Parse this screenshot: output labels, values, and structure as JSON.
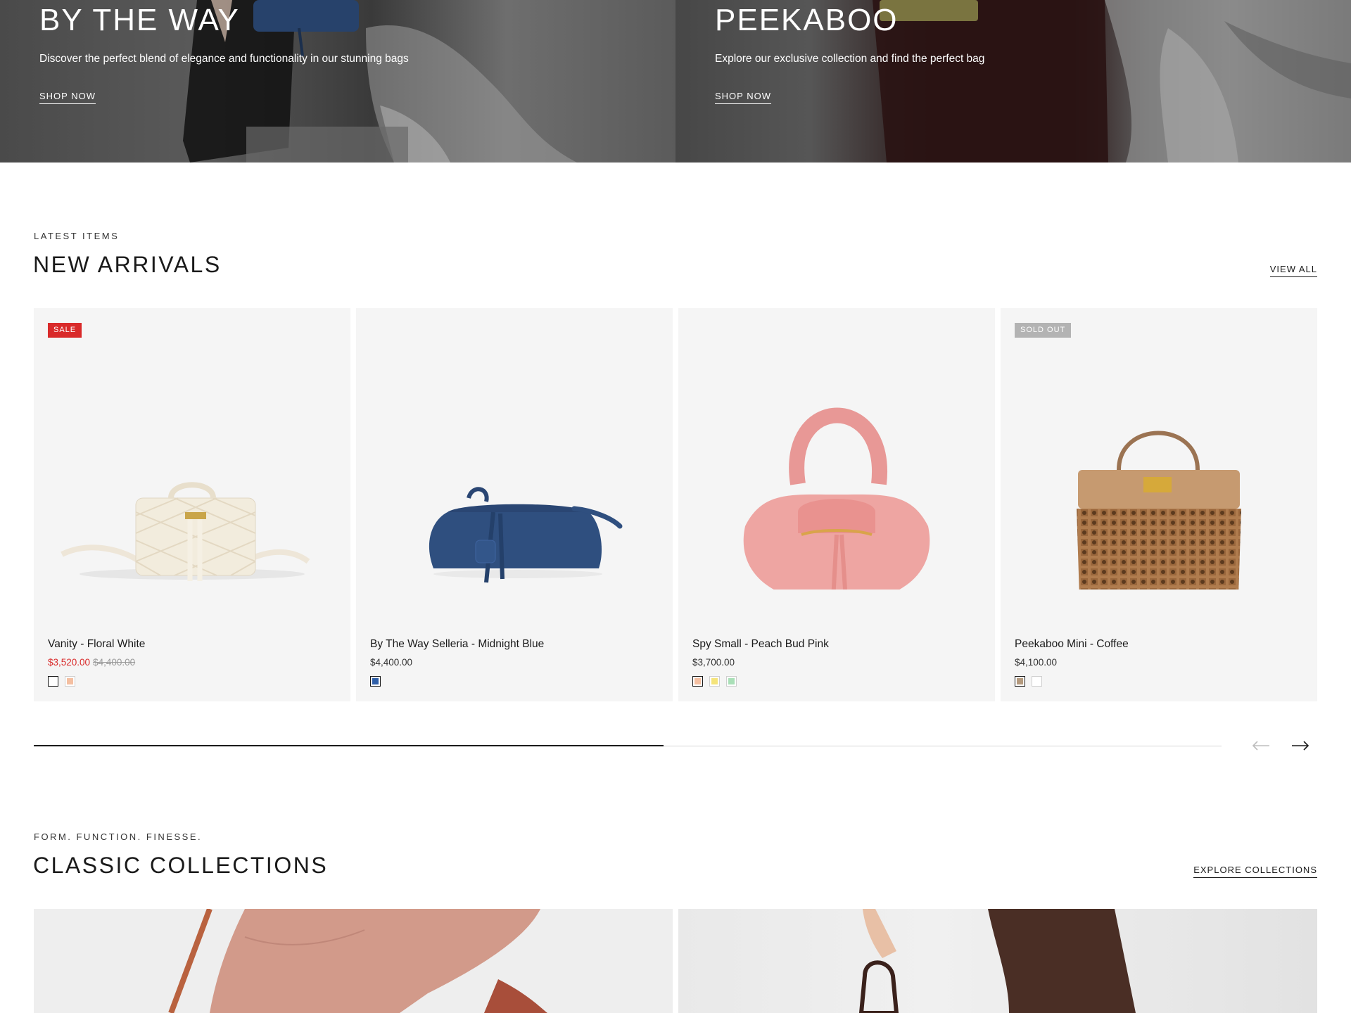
{
  "hero": [
    {
      "title": "BY THE WAY",
      "description": "Discover the perfect blend of elegance and functionality in our stunning bags",
      "cta": "SHOP NOW"
    },
    {
      "title": "PEEKABOO",
      "description": "Explore our exclusive collection and find the perfect bag",
      "cta": "SHOP NOW"
    }
  ],
  "new_arrivals": {
    "eyebrow": "LATEST ITEMS",
    "title": "NEW ARRIVALS",
    "view_all": "VIEW ALL",
    "products": [
      {
        "badge": "SALE",
        "name": "Vanity - Floral White",
        "price": "$3,520.00",
        "old_price": "$4,400.00",
        "swatches": [
          "#ffffff",
          "#f4bfa1"
        ]
      },
      {
        "badge": "",
        "name": "By The Way Selleria - Midnight Blue",
        "price": "$4,400.00",
        "old_price": "",
        "swatches": [
          "#2f5fa8"
        ]
      },
      {
        "badge": "",
        "name": "Spy Small - Peach Bud Pink",
        "price": "$3,700.00",
        "old_price": "",
        "swatches": [
          "#f4bfa1",
          "#f5e47a",
          "#a9dfb7"
        ]
      },
      {
        "badge": "SOLD OUT",
        "name": "Peekaboo Mini - Coffee",
        "price": "$4,100.00",
        "old_price": "",
        "swatches": [
          "#b49a7e",
          "#ffffff"
        ]
      }
    ],
    "slider_progress": 0.53
  },
  "collections": {
    "eyebrow": "FORM. FUNCTION. FINESSE.",
    "title": "CLASSIC COLLECTIONS",
    "explore": "EXPLORE COLLECTIONS"
  },
  "colors": {
    "sale_red": "#d92a2a",
    "card_bg": "#f5f5f5",
    "sold_out_grey": "#b3b3b3",
    "text_dark": "#1a1a1a"
  }
}
